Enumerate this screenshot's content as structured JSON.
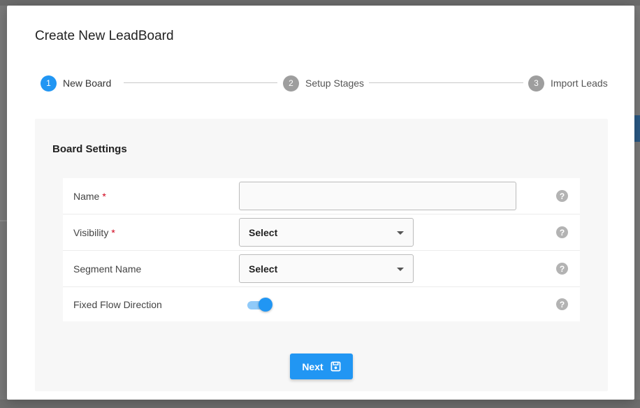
{
  "dialog": {
    "title": "Create New LeadBoard"
  },
  "stepper": {
    "steps": [
      {
        "number": "1",
        "label": "New Board",
        "active": true
      },
      {
        "number": "2",
        "label": "Setup Stages",
        "active": false
      },
      {
        "number": "3",
        "label": "Import Leads",
        "active": false
      }
    ]
  },
  "board_settings": {
    "title": "Board Settings",
    "fields": {
      "name": {
        "label": "Name",
        "required_mark": "*",
        "value": ""
      },
      "visibility": {
        "label": "Visibility",
        "required_mark": "*",
        "value": "Select"
      },
      "segment_name": {
        "label": "Segment Name",
        "value": "Select"
      },
      "fixed_flow_direction": {
        "label": "Fixed Flow Direction",
        "enabled": true
      }
    },
    "help_glyph": "?"
  },
  "actions": {
    "next_label": "Next"
  },
  "colors": {
    "primary": "#2196f3",
    "step_inactive": "#9e9e9e",
    "required": "#d0021b"
  },
  "icons": {
    "help": "help-circle-icon",
    "save": "save-icon",
    "dropdown": "caret-down-icon"
  }
}
